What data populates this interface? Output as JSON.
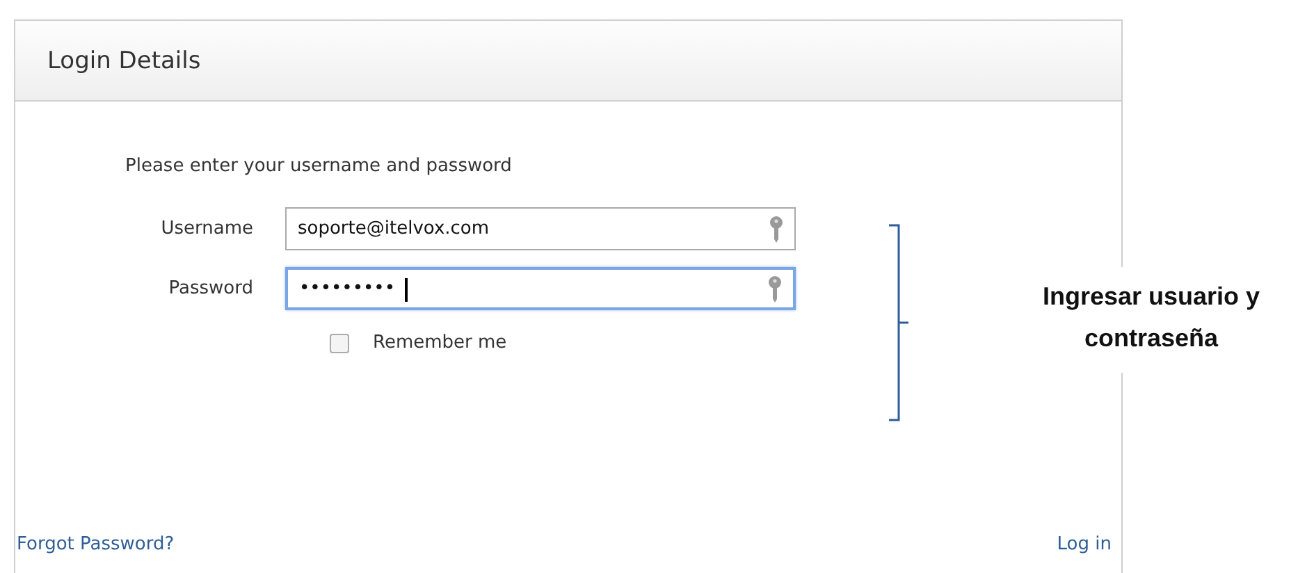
{
  "panel": {
    "title": "Login Details",
    "intro": "Please enter your username and password",
    "fields": [
      {
        "label": "Username",
        "value": "soporte@itelvox.com",
        "focused": false
      },
      {
        "label": "Password",
        "value": "•••••••••",
        "focused": true
      }
    ],
    "remember": {
      "label": "Remember me",
      "checked": false
    },
    "links": [
      "Forgot Password?",
      "Log in"
    ]
  },
  "annotation": {
    "text": "Ingresar usuario y contraseña"
  }
}
